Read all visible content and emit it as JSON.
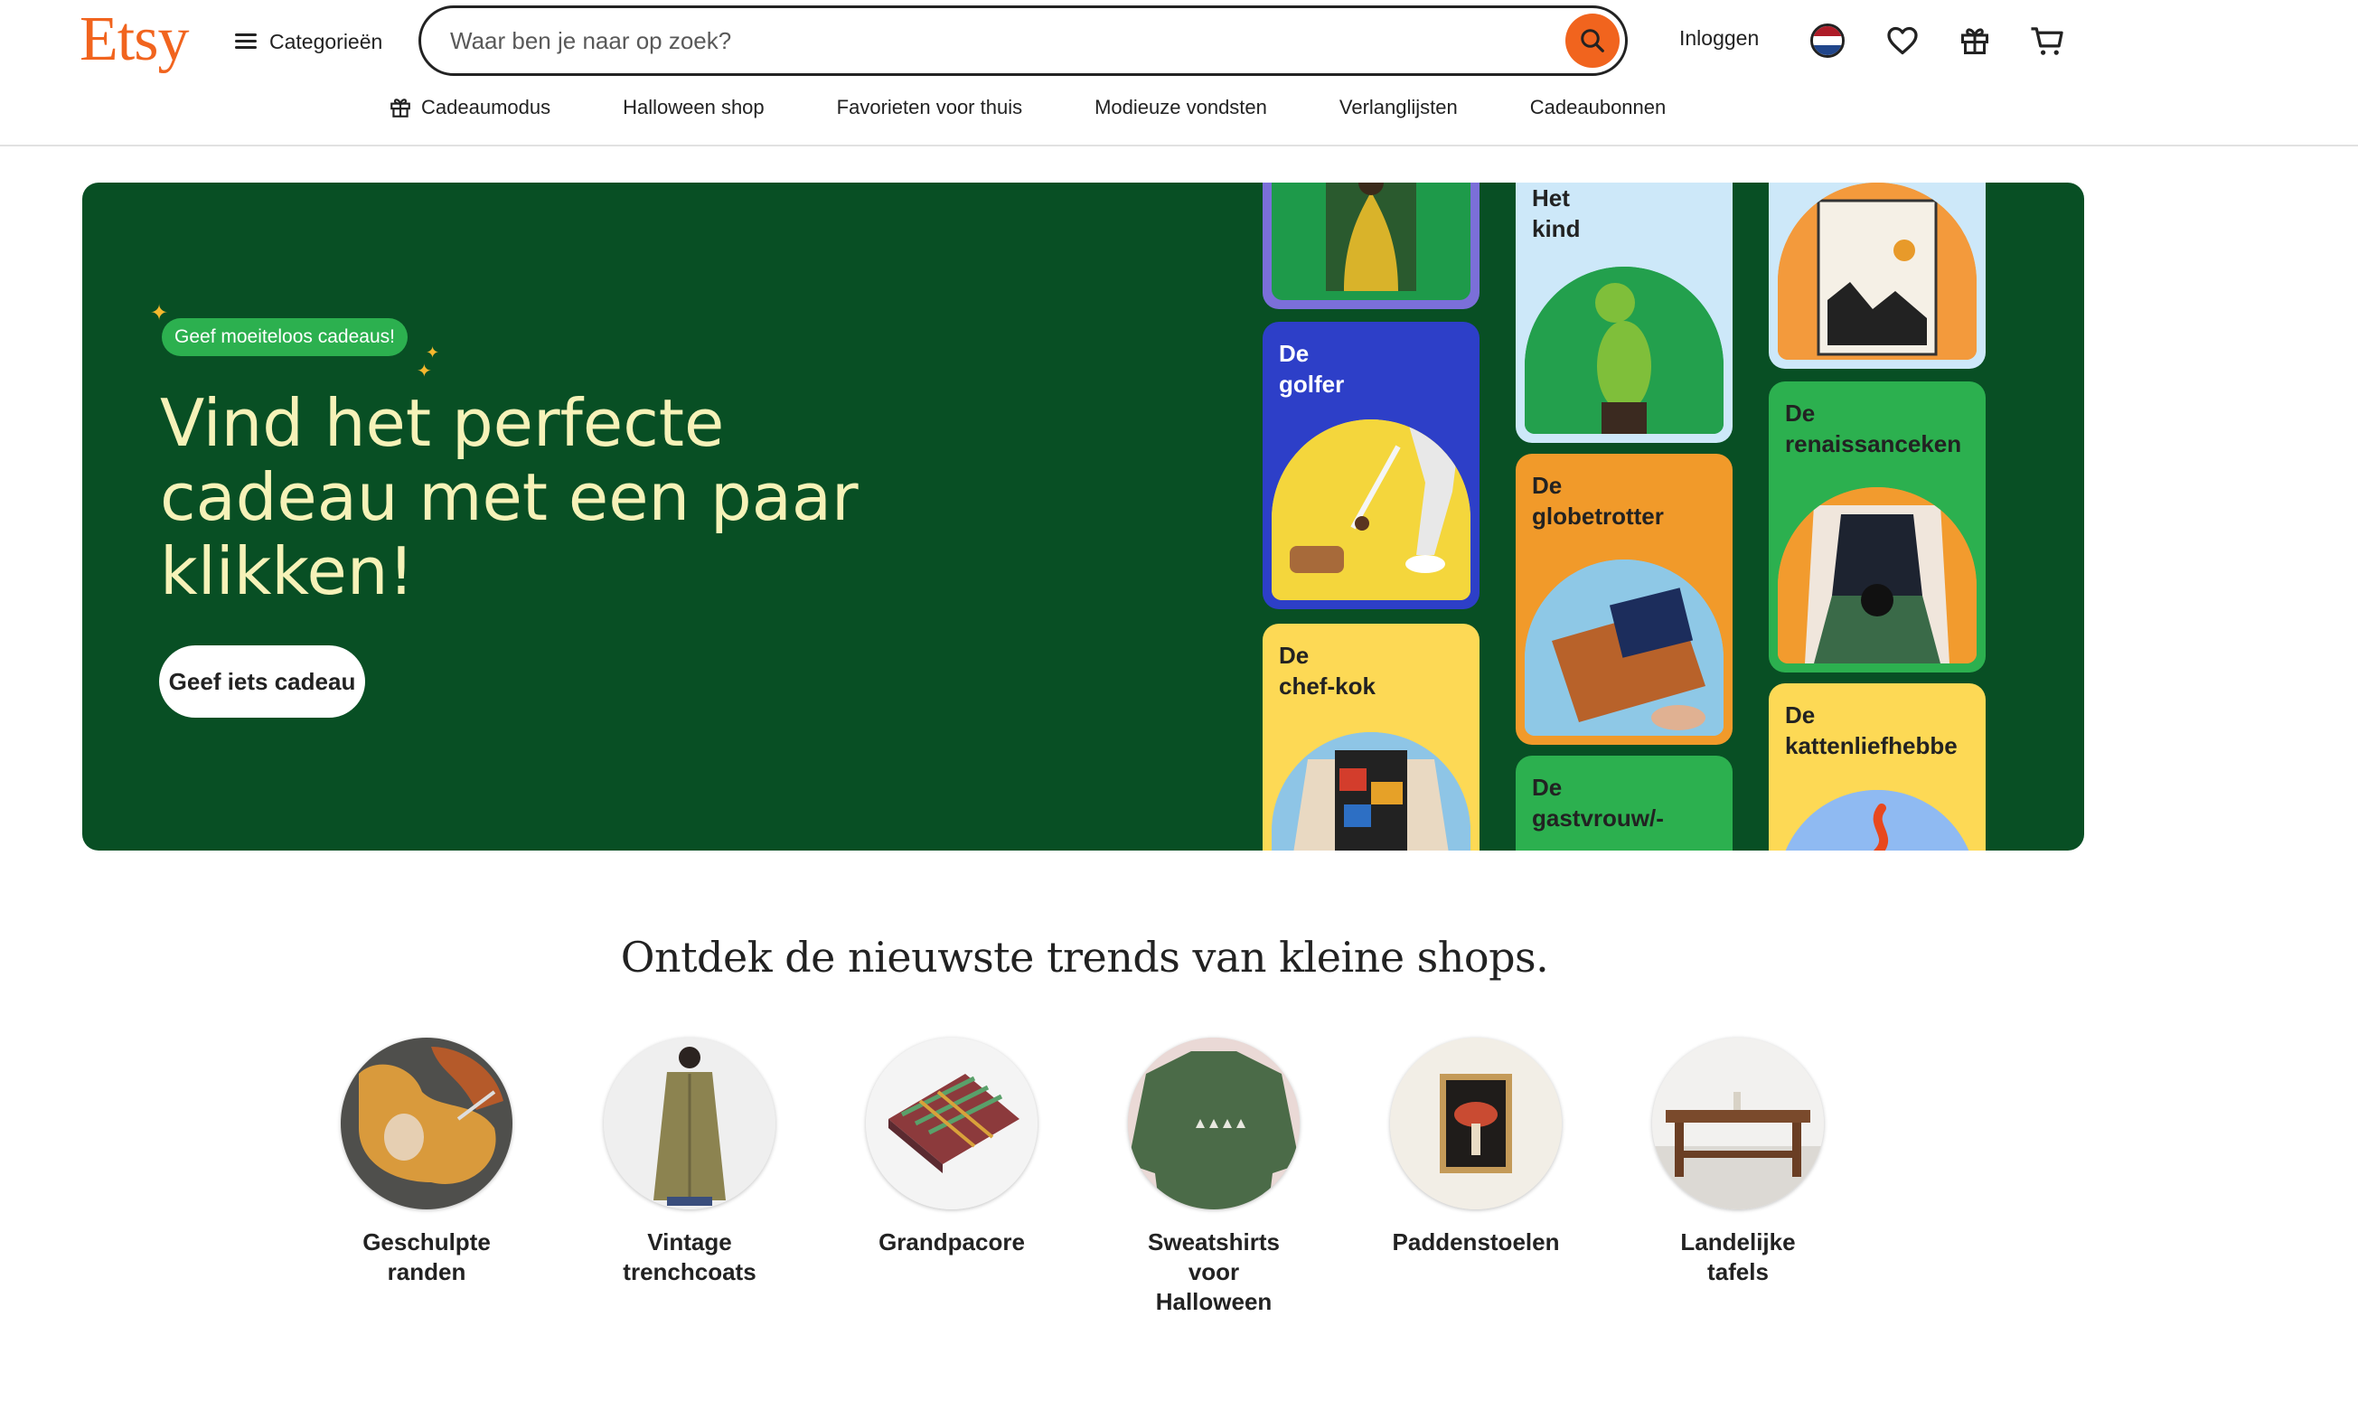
{
  "header": {
    "logo": "Etsy",
    "categories_label": "Categorieën",
    "search_placeholder": "Waar ben je naar op zoek?",
    "signin_label": "Inloggen",
    "brand_color": "#f1641e"
  },
  "subnav": [
    {
      "label": "Cadeaumodus",
      "icon": "gift-icon"
    },
    {
      "label": "Halloween shop"
    },
    {
      "label": "Favorieten voor thuis"
    },
    {
      "label": "Modieuze vondsten"
    },
    {
      "label": "Verlanglijsten"
    },
    {
      "label": "Cadeaubonnen"
    }
  ],
  "hero": {
    "badge": "Geef moeiteloos cadeaus!",
    "title": "Vind het perfecte cadeau met een paar klikken!",
    "cta": "Geef iets cadeau",
    "background": "#084f24",
    "cards": [
      {
        "title": "",
        "color": "#7b6fd9"
      },
      {
        "title": "De\ngolfer",
        "color": "#2d3fc8",
        "title_color": "#ffffff"
      },
      {
        "title": "De\nchef-kok",
        "color": "#fdd955"
      },
      {
        "title": "Het\nkind",
        "color": "#cde8f9"
      },
      {
        "title": "De\nglobetrotter",
        "color": "#f19a2a"
      },
      {
        "title": "De\ngastvrouw/-",
        "color": "#2cb04f"
      },
      {
        "title": "",
        "color": "#cde8f9"
      },
      {
        "title": "De\nrenaissanceken",
        "color": "#2cb04f"
      },
      {
        "title": "De\nkattenliefhebbe",
        "color": "#fdd955"
      }
    ]
  },
  "trends": {
    "title": "Ontdek de nieuwste trends van kleine shops.",
    "items": [
      {
        "label": "Geschulpte\nranden"
      },
      {
        "label": "Vintage\ntrenchcoats"
      },
      {
        "label": "Grandpacore"
      },
      {
        "label": "Sweatshirts\nvoor\nHalloween"
      },
      {
        "label": "Paddenstoelen"
      },
      {
        "label": "Landelijke\ntafels"
      }
    ]
  }
}
